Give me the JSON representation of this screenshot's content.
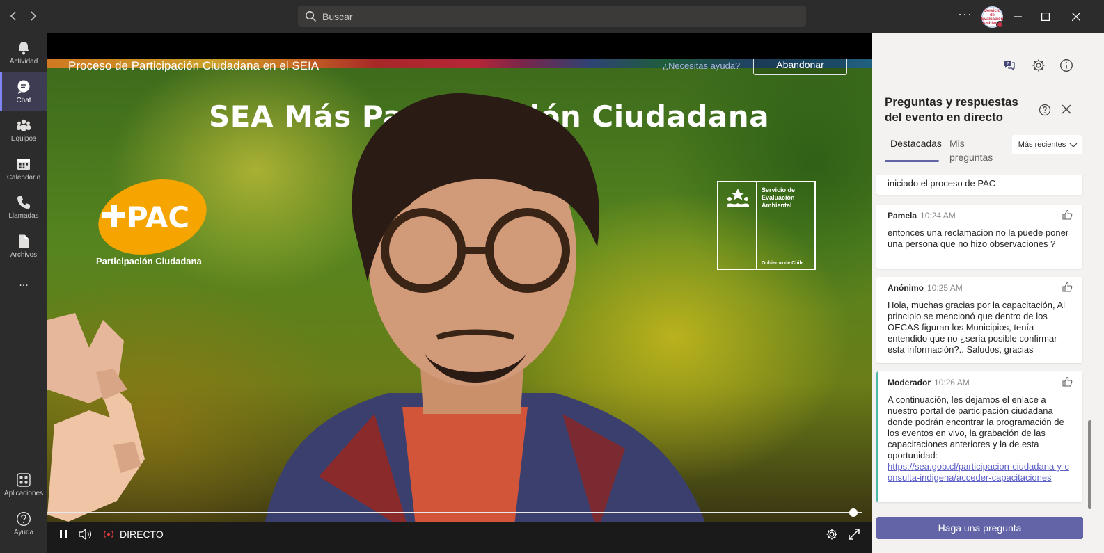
{
  "search": {
    "placeholder": "Buscar"
  },
  "account": {
    "avatar_text": "Servicio de Evaluación Ambiental"
  },
  "rail": {
    "items": [
      {
        "label": "Actividad",
        "icon": "bell-icon"
      },
      {
        "label": "Chat",
        "icon": "chat-icon"
      },
      {
        "label": "Equipos",
        "icon": "teams-icon"
      },
      {
        "label": "Calendario",
        "icon": "calendar-icon"
      },
      {
        "label": "Llamadas",
        "icon": "phone-icon"
      },
      {
        "label": "Archivos",
        "icon": "file-icon"
      }
    ],
    "more": "...",
    "bottom": [
      {
        "label": "Aplicaciones",
        "icon": "apps-icon"
      },
      {
        "label": "Ayuda",
        "icon": "help-icon"
      }
    ],
    "active": "Chat"
  },
  "event": {
    "title": "Proceso de Participación Ciudadana en el SEIA",
    "help_link": "¿Necesitas ayuda?",
    "leave_label": "Abandonar",
    "banner": "SEA Más Participación Ciudadana",
    "pac_logo": "PAC",
    "pac_subtitle": "Participación Ciudadana",
    "sea_logo": {
      "line1": "Servicio de",
      "line2": "Evaluación",
      "line3": "Ambiental",
      "footer": "Gobierno de Chile"
    },
    "live_label": "DIRECTO",
    "progress_fraction": 0.99
  },
  "qa": {
    "title": "Preguntas y respuestas del evento en directo",
    "tabs": [
      {
        "label": "Destacadas",
        "active": true
      },
      {
        "label": "Mis preguntas",
        "active": false
      }
    ],
    "sort": "Más recientes",
    "partial_message": "iniciado el proceso de PAC",
    "messages": [
      {
        "author": "Pamela",
        "time": "10:24 AM",
        "text": "entonces una reclamacion no la puede poner una persona que no hizo observaciones ?"
      },
      {
        "author": "Anónimo",
        "time": "10:25 AM",
        "text": "Hola, muchas gracias por la capacitación, Al principio se mencionó que dentro de los OECAS figuran los Municipios, tenía entendido que no ¿sería posible confirmar esta información?.. Saludos, gracias"
      },
      {
        "author": "Moderador",
        "time": "10:26 AM",
        "text": "A continuación, les dejamos el enlace a nuestro portal de participación ciudadana donde podrán encontrar la programación de los eventos en vivo, la grabación de las capacitaciones anteriores y la de esta oportunidad:",
        "link": "https://sea.gob.cl/participacion-ciudadana-y-consulta-indigena/acceder-capacitaciones"
      }
    ],
    "ask_label": "Haga una pregunta"
  },
  "colors": {
    "accent": "#6264a7",
    "moderator": "#4fb8a7",
    "pac_orange": "#f5a400",
    "rail_bg": "#2d2c2c"
  }
}
